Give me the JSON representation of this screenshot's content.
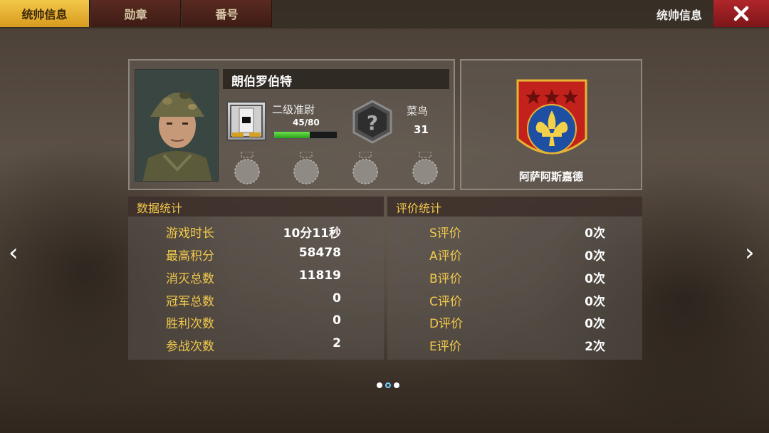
{
  "tabs": [
    {
      "label": "统帅信息"
    },
    {
      "label": "勋章"
    },
    {
      "label": "番号"
    }
  ],
  "header": {
    "title": "统帅信息"
  },
  "profile": {
    "name": "朗伯罗伯特",
    "rank": "二级准尉",
    "xp": "45/80",
    "xp_progress": 0.5625,
    "level_title": "菜鸟",
    "level": "31"
  },
  "faction": {
    "name": "阿萨阿斯嘉德",
    "color": "#c3221c"
  },
  "data_stats": {
    "heading": "数据统计",
    "rows": [
      {
        "label": "游戏时长",
        "value": "10分11秒"
      },
      {
        "label": "最高积分",
        "value": "58478"
      },
      {
        "label": "消灭总数",
        "value": "11819"
      },
      {
        "label": "冠军总数",
        "value": "0"
      },
      {
        "label": "胜利次数",
        "value": "0"
      },
      {
        "label": "参战次数",
        "value": "2"
      }
    ]
  },
  "rating_stats": {
    "heading": "评价统计",
    "rows": [
      {
        "label": "S评价",
        "value": "0次"
      },
      {
        "label": "A评价",
        "value": "0次"
      },
      {
        "label": "B评价",
        "value": "0次"
      },
      {
        "label": "C评价",
        "value": "0次"
      },
      {
        "label": "D评价",
        "value": "0次"
      },
      {
        "label": "E评价",
        "value": "2次"
      }
    ]
  },
  "nav": {
    "prev": "‹",
    "next": "›"
  },
  "pagination": {
    "total": 3,
    "current": 2
  },
  "colors": {
    "accent": "#f2c94c",
    "tab_active": "#e7b533",
    "close": "#a3202a",
    "xp": "#3fbf2a"
  }
}
